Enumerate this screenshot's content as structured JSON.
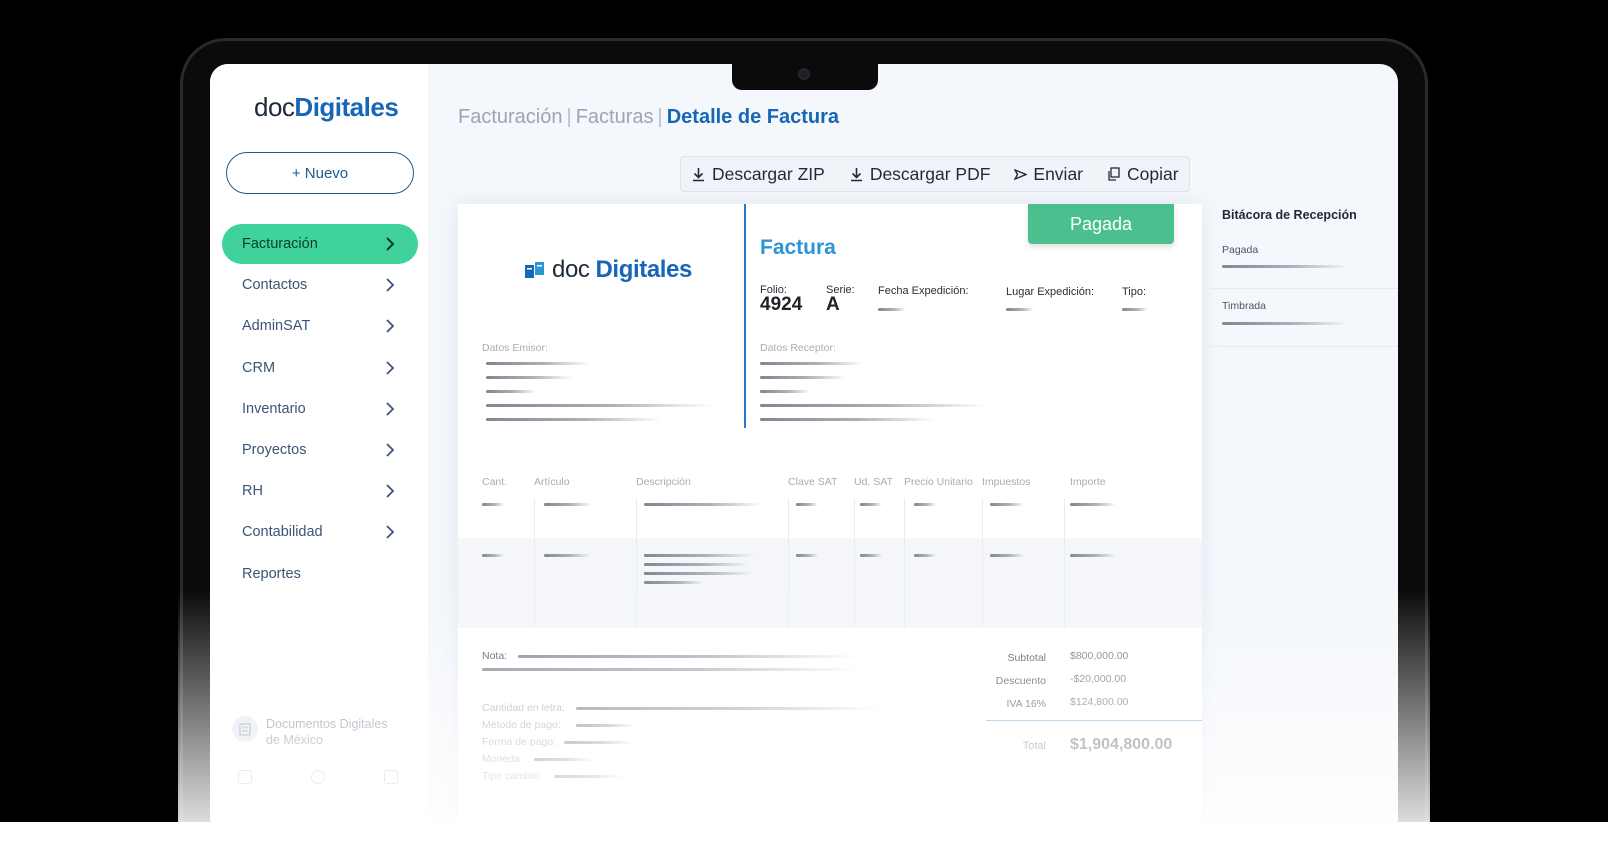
{
  "sidebar": {
    "logo_light": "doc",
    "logo_bold": "Digitales",
    "new_button": "+ Nuevo",
    "items": [
      {
        "label": "Facturación",
        "active": true
      },
      {
        "label": "Contactos"
      },
      {
        "label": "AdminSAT"
      },
      {
        "label": "CRM"
      },
      {
        "label": "Inventario"
      },
      {
        "label": "Proyectos"
      },
      {
        "label": "RH"
      },
      {
        "label": "Contabilidad"
      },
      {
        "label": "Reportes"
      }
    ],
    "company_line1": "Documentos Digitales",
    "company_line2": "de México"
  },
  "breadcrumb": {
    "level1": "Facturación",
    "level2": "Facturas",
    "current": "Detalle de Factura"
  },
  "toolbar": {
    "zip": "Descargar ZIP",
    "pdf": "Descargar PDF",
    "send": "Enviar",
    "copy": "Copiar"
  },
  "invoice": {
    "logo_light": "doc",
    "logo_bold": "Digitales",
    "title": "Factura",
    "status": "Pagada",
    "folio_label": "Folio:",
    "folio_value": "4924",
    "serie_label": "Serie:",
    "serie_value": "A",
    "fecha_label": "Fecha Expedición:",
    "lugar_label": "Lugar Expedición:",
    "tipo_label": "Tipo:",
    "emisor_label": "Datos Emisor:",
    "receptor_label": "Datos Receptor:",
    "columns": [
      "Cant.",
      "Artículo",
      "Descripción",
      "Clave SAT",
      "Ud. SAT",
      "Precio Unitario",
      "Impuestos",
      "Importe"
    ],
    "nota_label": "Nota:",
    "cantidad_letra_label": "Cantidad en letra:",
    "metodo_pago_label": "Método de pago:",
    "forma_pago_label": "Forma de pago:",
    "moneda_label": "Moneda:",
    "tipo_cambio_label": "Tipo cambio:",
    "subtotal_label": "Subtotal",
    "subtotal_value": "$800,000.00",
    "descuento_label": "Descuento",
    "descuento_value": "-$20,000.00",
    "iva_label": "IVA 16%",
    "iva_value": "$124,800.00",
    "total_label": "Total",
    "total_value": "$1,904,800.00"
  },
  "log": {
    "title": "Bitácora de Recepción",
    "items": [
      "Pagada",
      "Timbrada"
    ]
  },
  "colors": {
    "brand_blue": "#1766b8",
    "active_green": "#3fd39b",
    "paid_green": "#4bbf8d",
    "title_blue": "#2a96d2"
  }
}
